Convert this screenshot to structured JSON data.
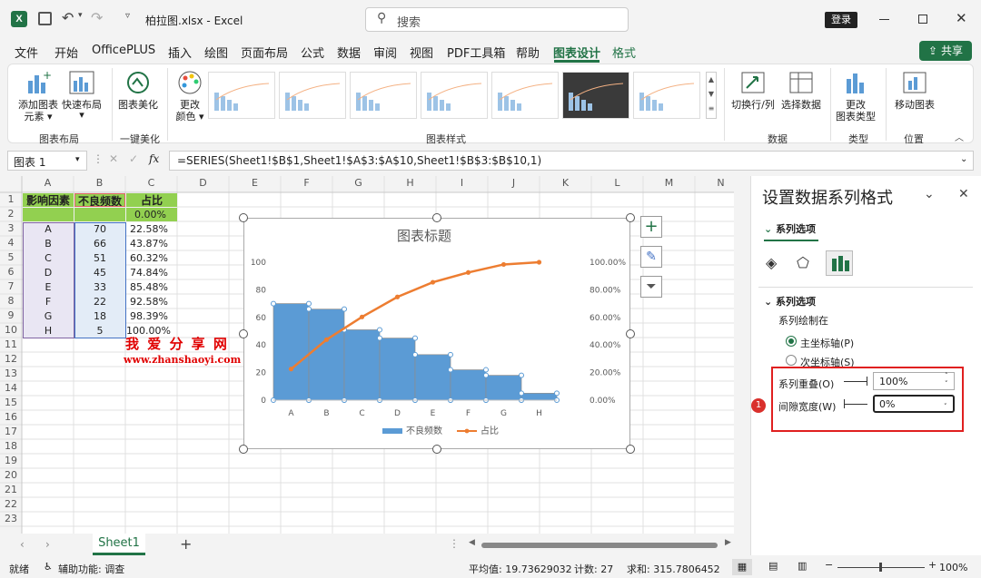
{
  "titlebar": {
    "filename": "柏拉图.xlsx",
    "app": "Excel",
    "search_placeholder": "搜索",
    "login": "登录",
    "share": "共享",
    "save_icon": "save-icon",
    "undo_icon": "undo-icon"
  },
  "tabs": [
    "文件",
    "开始",
    "OfficePLUS",
    "插入",
    "绘图",
    "页面布局",
    "公式",
    "数据",
    "审阅",
    "视图",
    "PDF工具箱",
    "帮助",
    "图表设计",
    "格式"
  ],
  "active_tab": "图表设计",
  "ribbon": {
    "add_element_1": "添加图表",
    "add_element_2": "元素",
    "quick_layout": "快速布局",
    "beautify": "图表美化",
    "change_color_1": "更改",
    "change_color_2": "颜色",
    "switch_rowcol": "切换行/列",
    "select_data": "选择数据",
    "change_type_1": "更改",
    "change_type_2": "图表类型",
    "move_chart": "移动图表",
    "grp_layout": "图表布局",
    "grp_beautify": "一键美化",
    "grp_styles": "图表样式",
    "grp_data": "数据",
    "grp_type": "类型",
    "grp_position": "位置"
  },
  "formula_bar": {
    "name_box": "图表 1",
    "fx": "fx",
    "formula": "=SERIES(Sheet1!$B$1,Sheet1!$A$3:$A$10,Sheet1!$B$3:$B$10,1)"
  },
  "sheet": {
    "columns": [
      "A",
      "B",
      "C",
      "D",
      "E",
      "F",
      "G",
      "H",
      "I",
      "J",
      "K",
      "L",
      "M",
      "N"
    ],
    "rows": [
      "1",
      "2",
      "3",
      "4",
      "5",
      "6",
      "7",
      "8",
      "9",
      "10",
      "11",
      "12",
      "13",
      "14",
      "15",
      "16",
      "17",
      "18",
      "19",
      "20",
      "21",
      "22",
      "23"
    ],
    "header_row": [
      "影响因素",
      "不良频数",
      "占比"
    ],
    "row2_c": "0.00%",
    "data": [
      [
        "A",
        "70",
        "22.58%"
      ],
      [
        "B",
        "66",
        "43.87%"
      ],
      [
        "C",
        "51",
        "60.32%"
      ],
      [
        "D",
        "45",
        "74.84%"
      ],
      [
        "E",
        "33",
        "85.48%"
      ],
      [
        "F",
        "22",
        "92.58%"
      ],
      [
        "G",
        "18",
        "98.39%"
      ],
      [
        "H",
        "5",
        "100.00%"
      ]
    ],
    "watermark": "我 爱 分 享 网",
    "watermark_url": "www.zhanshaoyi.com",
    "tab": "Sheet1",
    "colors": {
      "header_bg": "#92d050",
      "accent": "#217346"
    }
  },
  "chart_data": {
    "type": "bar",
    "title": "图表标题",
    "categories": [
      "A",
      "B",
      "C",
      "D",
      "E",
      "F",
      "G",
      "H"
    ],
    "series": [
      {
        "name": "不良频数",
        "type": "bar",
        "axis": "primary",
        "values": [
          70,
          66,
          51,
          45,
          33,
          22,
          18,
          5
        ],
        "color": "#5b9bd5"
      },
      {
        "name": "占比",
        "type": "line",
        "axis": "secondary",
        "values": [
          22.58,
          43.87,
          60.32,
          74.84,
          85.48,
          92.58,
          98.39,
          100.0
        ],
        "color": "#ed7d31"
      }
    ],
    "ylim": [
      0,
      100
    ],
    "y_ticks": [
      "0",
      "20",
      "40",
      "60",
      "80",
      "100"
    ],
    "y2lim": [
      0,
      100
    ],
    "y2_ticks": [
      "0.00%",
      "20.00%",
      "40.00%",
      "60.00%",
      "80.00%",
      "100.00%"
    ],
    "legend": "bottom",
    "grid": false
  },
  "panel": {
    "title": "设置数据系列格式",
    "section_tab": "系列选项",
    "section": "系列选项",
    "plot_on": "系列绘制在",
    "primary_axis": "主坐标轴(P)",
    "secondary_axis": "次坐标轴(S)",
    "overlap_label": "系列重叠(O)",
    "overlap_value": "100%",
    "gap_label": "间隙宽度(W)",
    "gap_value": "0%",
    "badge": "1"
  },
  "status": {
    "ready": "就绪",
    "accessibility": "辅助功能: 调查",
    "average": "平均值: 19.73629032",
    "count": "计数: 27",
    "sum": "求和: 315.7806452",
    "zoom": "100%"
  }
}
